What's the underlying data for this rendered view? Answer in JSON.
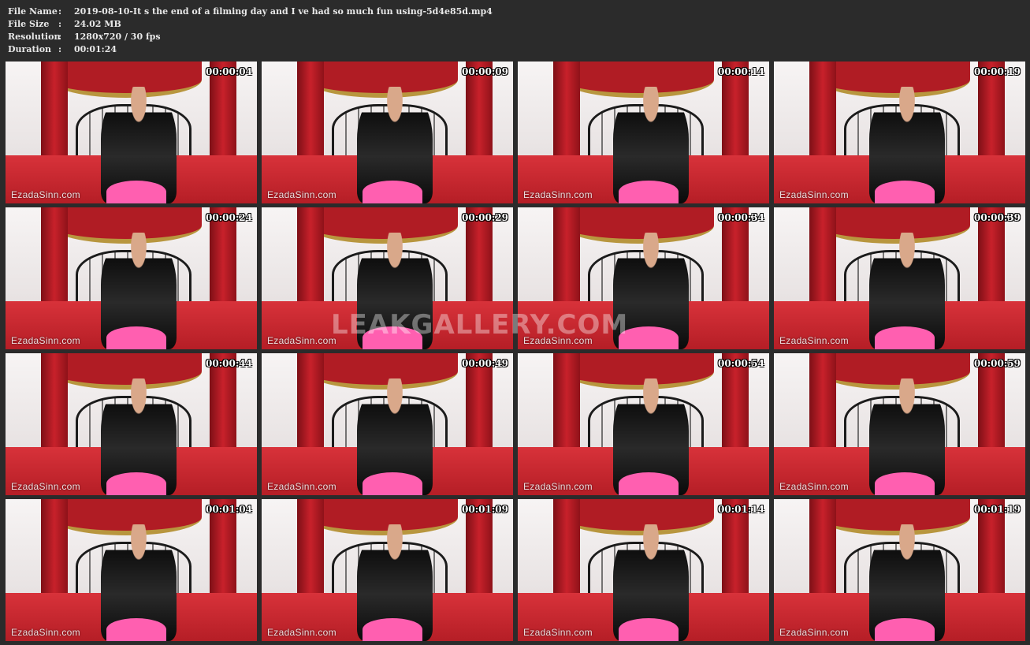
{
  "file_info": {
    "rows": [
      {
        "key": "File Name",
        "sep": ":",
        "value": "2019-08-10-It s the end of a filming day and I ve had so much fun using-5d4e85d.mp4"
      },
      {
        "key": "File Size",
        "sep": ":",
        "value": "24.02 MB"
      },
      {
        "key": "Resolution",
        "sep": ":",
        "value": "1280x720 / 30 fps"
      },
      {
        "key": "Duration",
        "sep": ":",
        "value": "00:01:24"
      }
    ]
  },
  "overlay_watermark": "LEAKGALLERY.COM",
  "thumbnails": [
    {
      "timestamp": "00:00:04",
      "watermark": "EzadaSinn.com"
    },
    {
      "timestamp": "00:00:09",
      "watermark": "EzadaSinn.com"
    },
    {
      "timestamp": "00:00:14",
      "watermark": "EzadaSinn.com"
    },
    {
      "timestamp": "00:00:19",
      "watermark": "EzadaSinn.com"
    },
    {
      "timestamp": "00:00:24",
      "watermark": "EzadaSinn.com"
    },
    {
      "timestamp": "00:00:29",
      "watermark": "EzadaSinn.com"
    },
    {
      "timestamp": "00:00:34",
      "watermark": "EzadaSinn.com"
    },
    {
      "timestamp": "00:00:39",
      "watermark": "EzadaSinn.com"
    },
    {
      "timestamp": "00:00:44",
      "watermark": "EzadaSinn.com"
    },
    {
      "timestamp": "00:00:49",
      "watermark": "EzadaSinn.com"
    },
    {
      "timestamp": "00:00:54",
      "watermark": "EzadaSinn.com"
    },
    {
      "timestamp": "00:00:59",
      "watermark": "EzadaSinn.com"
    },
    {
      "timestamp": "00:01:04",
      "watermark": "EzadaSinn.com"
    },
    {
      "timestamp": "00:01:09",
      "watermark": "EzadaSinn.com"
    },
    {
      "timestamp": "00:01:14",
      "watermark": "EzadaSinn.com"
    },
    {
      "timestamp": "00:01:19",
      "watermark": "EzadaSinn.com"
    }
  ],
  "colors": {
    "background": "#2b2b2b",
    "text": "#e8e8e8",
    "curtain": "#c8212b",
    "bedding": "#d8323a"
  }
}
